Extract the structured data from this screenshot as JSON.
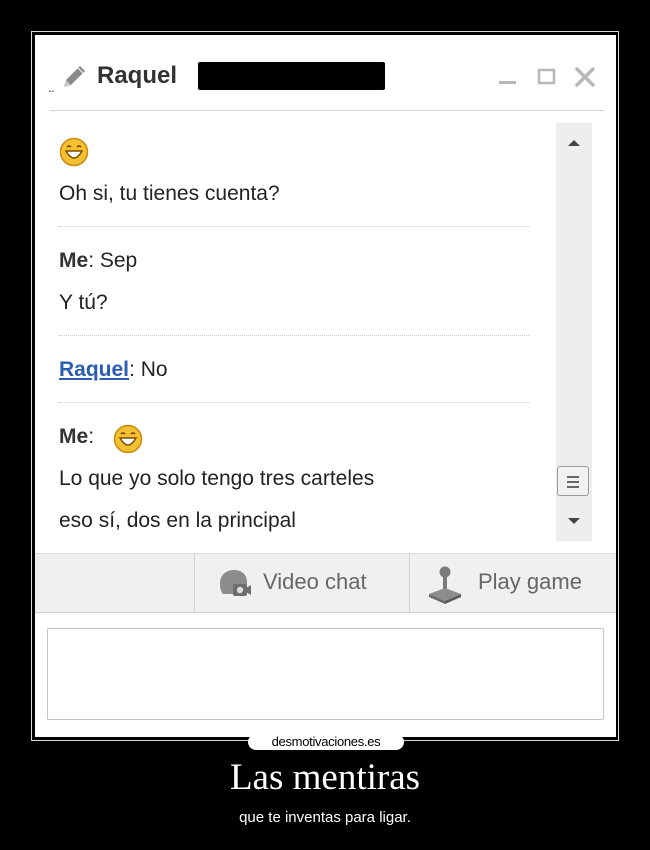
{
  "window": {
    "title_prefix": "..",
    "contact_name": "Raquel",
    "controls": [
      "minimize-icon",
      "maximize-icon",
      "close-icon"
    ]
  },
  "messages": [
    {
      "sender": "",
      "emoticon": "laughing-smiley-icon",
      "lines": [
        "Oh si, tu tienes cuenta?"
      ]
    },
    {
      "sender": "Me",
      "colon": ":",
      "lines": [
        "Sep",
        "Y tú?"
      ]
    },
    {
      "sender": "Raquel",
      "colon": ":",
      "lines": [
        "No"
      ]
    },
    {
      "sender": "Me",
      "colon": ":",
      "emoticon": "laughing-smiley-icon",
      "lines": [
        "Lo que yo solo tengo tres carteles",
        "eso sí, dos en la principal"
      ]
    }
  ],
  "toolbar": {
    "video_chat_label": "Video chat",
    "play_game_label": "Play game"
  },
  "input": {
    "value": ""
  },
  "watermark": "desmotivaciones.es",
  "caption": {
    "title": "Las mentiras",
    "subtitle": "que te inventas para ligar."
  },
  "colors": {
    "background": "#000000",
    "link": "#2a5db0",
    "toolbar": "#f0f0f0",
    "smiley": "#f5c030"
  }
}
